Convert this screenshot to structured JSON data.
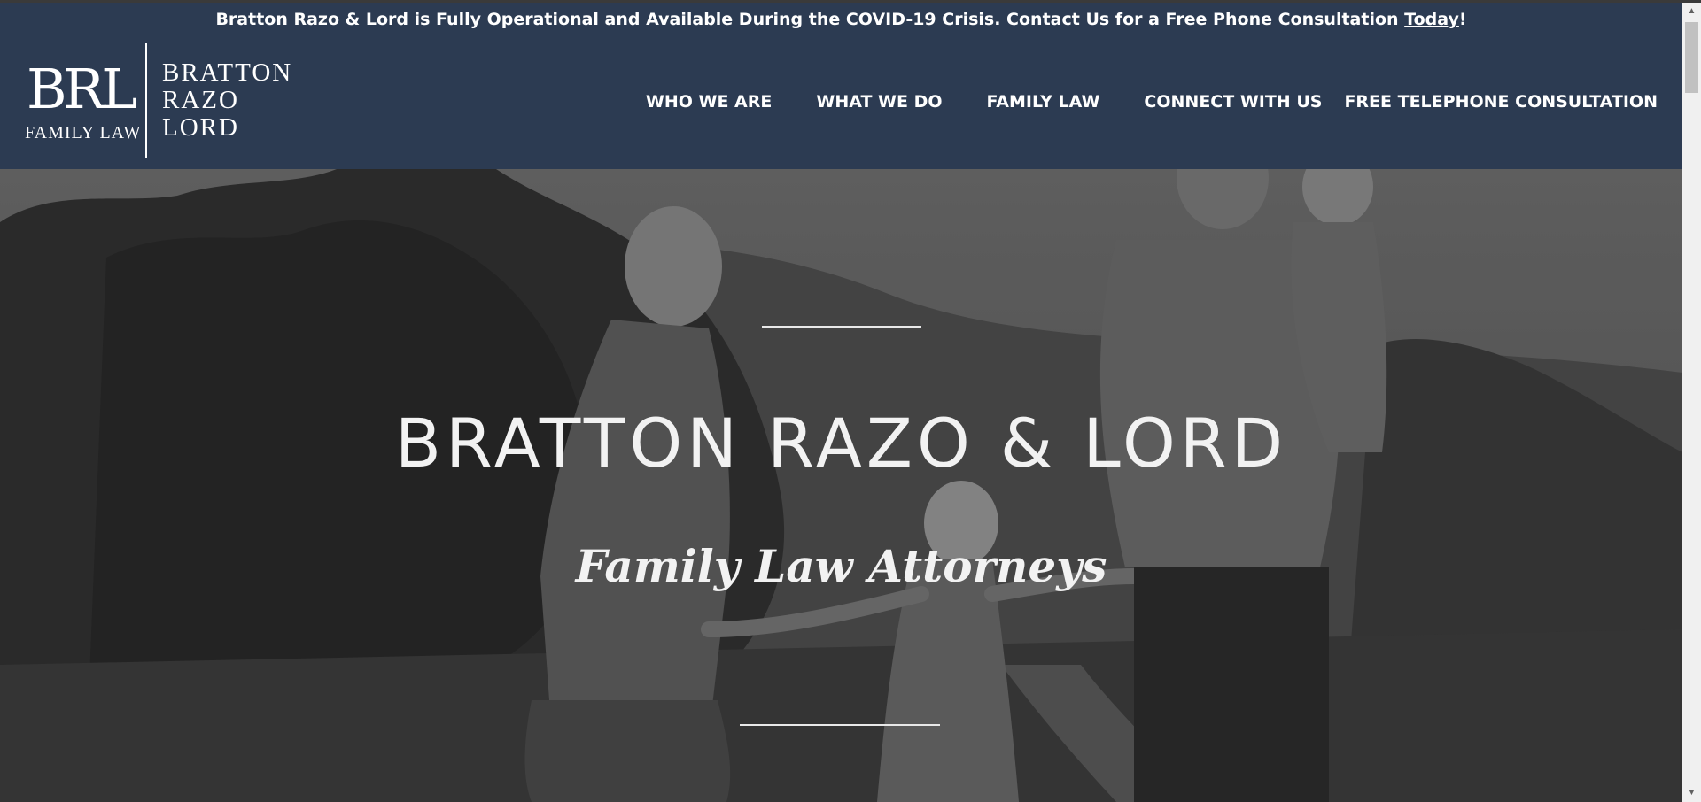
{
  "notice": {
    "text": "Bratton Razo & Lord is Fully Operational and Available During the COVID-19 Crisis. Contact Us for a Free Phone Consultation ",
    "link_text": "Today",
    "tail": "!"
  },
  "logo": {
    "mark": "BRL",
    "sub": "FAMILY LAW",
    "words": [
      "BRATTON",
      "RAZO",
      "LORD"
    ]
  },
  "nav": {
    "items": [
      "WHO WE ARE",
      "WHAT WE DO",
      "FAMILY LAW",
      "CONNECT WITH US",
      "FREE TELEPHONE CONSULTATION"
    ]
  },
  "hero": {
    "title": "BRATTON RAZO & LORD",
    "subtitle": "Family Law Attorneys"
  },
  "colors": {
    "header_bg": "#2c3b52",
    "text": "#ffffff"
  },
  "icons": {
    "scroll_up": "arrow-up-icon",
    "scroll_down": "arrow-down-icon"
  }
}
